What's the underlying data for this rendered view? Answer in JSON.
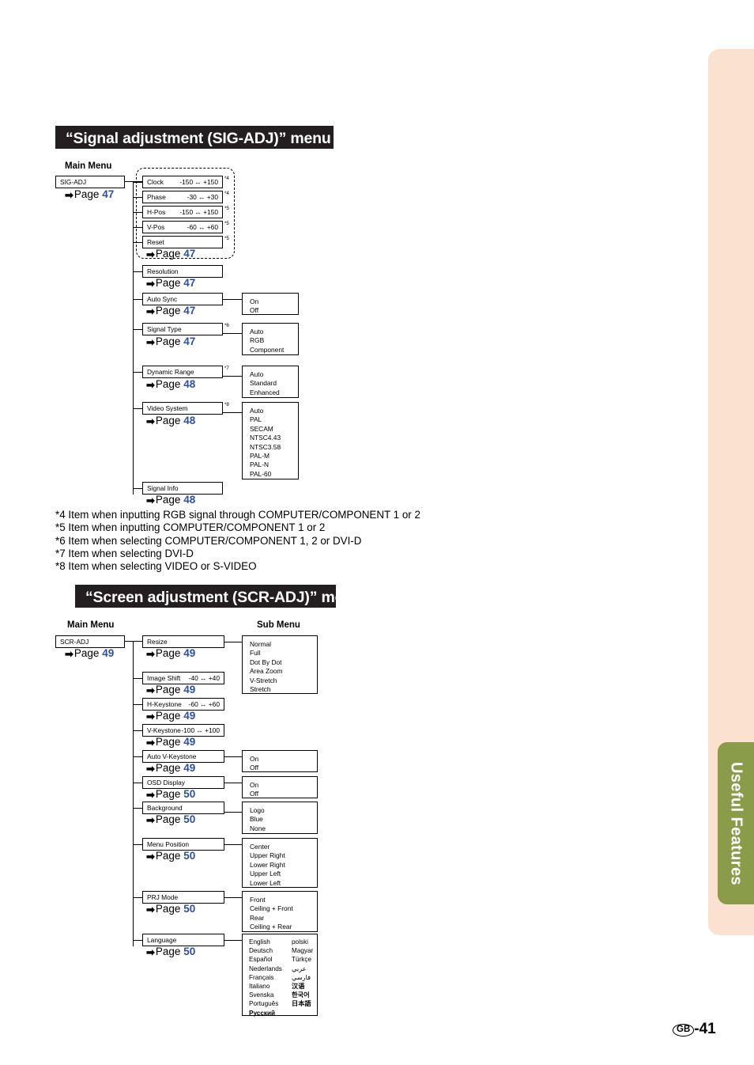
{
  "side_tab": {
    "label": "Useful Features",
    "bg_color": "#8a9b4a",
    "band_color": "#fae1d0"
  },
  "footer": {
    "region_code": "GB",
    "page_number": "-41"
  },
  "accent_color": "#2d4fa0",
  "sections": [
    {
      "id": "sig-adj",
      "heading": "“Signal adjustment (SIG-ADJ)” menu",
      "main_menu_label": "Main Menu",
      "root": {
        "label": "SIG-ADJ",
        "page_prefix": "Page",
        "page": "47"
      },
      "grouped": {
        "page_prefix": "Page",
        "page": "47",
        "items": [
          {
            "label": "Clock",
            "range": "-150 ↔ +150",
            "note": "*4"
          },
          {
            "label": "Phase",
            "range": "-30 ↔ +30",
            "note": "*4"
          },
          {
            "label": "H-Pos",
            "range": "-150 ↔ +150",
            "note": "*5"
          },
          {
            "label": "V-Pos",
            "range": "-60 ↔ +60",
            "note": "*5"
          },
          {
            "label": "Reset",
            "range": "",
            "note": "*5"
          }
        ]
      },
      "items": [
        {
          "label": "Resolution",
          "note": "",
          "page_prefix": "Page",
          "page": "47",
          "options": []
        },
        {
          "label": "Auto Sync",
          "note": "",
          "page_prefix": "Page",
          "page": "47",
          "options": [
            "On",
            "Off"
          ]
        },
        {
          "label": "Signal Type",
          "note": "*6",
          "page_prefix": "Page",
          "page": "47",
          "options": [
            "Auto",
            "RGB",
            "Component"
          ]
        },
        {
          "label": "Dynamic Range",
          "note": "*7",
          "page_prefix": "Page",
          "page": "48",
          "options": [
            "Auto",
            "Standard",
            "Enhanced"
          ]
        },
        {
          "label": "Video System",
          "note": "*8",
          "page_prefix": "Page",
          "page": "48",
          "options": [
            "Auto",
            "PAL",
            "SECAM",
            "NTSC4.43",
            "NTSC3.58",
            "PAL-M",
            "PAL-N",
            "PAL-60"
          ]
        },
        {
          "label": "Signal Info",
          "note": "",
          "page_prefix": "Page",
          "page": "48",
          "options": []
        }
      ],
      "footnotes": [
        "*4 Item when inputting RGB signal through COMPUTER/COMPONENT 1 or 2",
        "*5 Item when inputting COMPUTER/COMPONENT 1 or 2",
        "*6 Item when selecting COMPUTER/COMPONENT 1, 2 or DVI-D",
        "*7 Item when selecting DVI-D",
        "*8 Item when selecting VIDEO or S-VIDEO"
      ]
    },
    {
      "id": "scr-adj",
      "heading": "“Screen adjustment (SCR-ADJ)” menu",
      "main_menu_label": "Main Menu",
      "sub_menu_label": "Sub Menu",
      "root": {
        "label": "SCR-ADJ",
        "page_prefix": "Page",
        "page": "49"
      },
      "items": [
        {
          "label": "Resize",
          "range": "",
          "page_prefix": "Page",
          "page": "49",
          "options": [
            "Normal",
            "Full",
            "Dot By Dot",
            "Area Zoom",
            "V-Stretch",
            "Stretch"
          ]
        },
        {
          "label": "Image Shift",
          "range": "-40 ↔ +40",
          "page_prefix": "Page",
          "page": "49",
          "options": []
        },
        {
          "label": "H-Keystone",
          "range": "-60 ↔ +60",
          "page_prefix": "Page",
          "page": "49",
          "options": []
        },
        {
          "label": "V-Keystone",
          "range": "-100 ↔ +100",
          "page_prefix": "Page",
          "page": "49",
          "options": []
        },
        {
          "label": "Auto V-Keystone",
          "range": "",
          "page_prefix": "Page",
          "page": "49",
          "options": [
            "On",
            "Off"
          ]
        },
        {
          "label": "OSD Display",
          "range": "",
          "page_prefix": "Page",
          "page": "50",
          "options": [
            "On",
            "Off"
          ]
        },
        {
          "label": "Background",
          "range": "",
          "page_prefix": "Page",
          "page": "50",
          "options": [
            "Logo",
            "Blue",
            "None"
          ]
        },
        {
          "label": "Menu Position",
          "range": "",
          "page_prefix": "Page",
          "page": "50",
          "options": [
            "Center",
            "Upper Right",
            "Lower Right",
            "Upper Left",
            "Lower Left"
          ]
        },
        {
          "label": "PRJ Mode",
          "range": "",
          "page_prefix": "Page",
          "page": "50",
          "options": [
            "Front",
            "Ceiling + Front",
            "Rear",
            "Ceiling + Rear"
          ]
        },
        {
          "label": "Language",
          "range": "",
          "page_prefix": "Page",
          "page": "50",
          "options": []
        }
      ],
      "language_options": {
        "left": [
          "English",
          "Deutsch",
          "Español",
          "Nederlands",
          "Français",
          "Italiano",
          "Svenska",
          "Português",
          "Русский"
        ],
        "right": [
          "polski",
          "Magyar",
          "Türkçe",
          "عربي",
          "فارسي",
          "汉语",
          "한국어",
          "日本語"
        ]
      }
    }
  ]
}
